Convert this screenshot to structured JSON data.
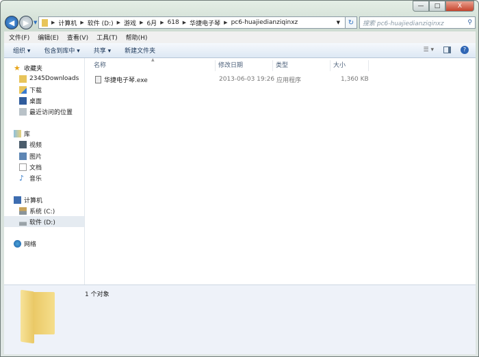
{
  "window": {
    "controls": {
      "minimize": "—",
      "maximize": "□",
      "close": "X"
    }
  },
  "address": {
    "path": [
      "计算机",
      "软件 (D:)",
      "游戏",
      "6月",
      "618",
      "华捷电子琴",
      "pc6-huajiedianziqinxz"
    ],
    "search_placeholder": "搜索 pc6-huajiedianziqinxz"
  },
  "menu": [
    "文件(F)",
    "编辑(E)",
    "查看(V)",
    "工具(T)",
    "帮助(H)"
  ],
  "toolbar": {
    "organize": "组织 ▾",
    "include": "包含到库中 ▾",
    "share": "共享 ▾",
    "new_folder": "新建文件夹"
  },
  "sidebar": {
    "favorites": "收藏夹",
    "fav_items": [
      "2345Downloads",
      "下载",
      "桌面",
      "最近访问的位置"
    ],
    "libraries": "库",
    "lib_items": [
      "视频",
      "图片",
      "文档",
      "音乐"
    ],
    "computer": "计算机",
    "drives": [
      "系统 (C:)",
      "软件 (D:)"
    ],
    "network": "网络"
  },
  "columns": [
    "名称",
    "修改日期",
    "类型",
    "大小"
  ],
  "files": [
    {
      "name": "华捷电子琴.exe",
      "date": "2013-06-03 19:26",
      "type": "应用程序",
      "size": "1,360 KB"
    }
  ],
  "details": {
    "count": "1 个对象"
  }
}
